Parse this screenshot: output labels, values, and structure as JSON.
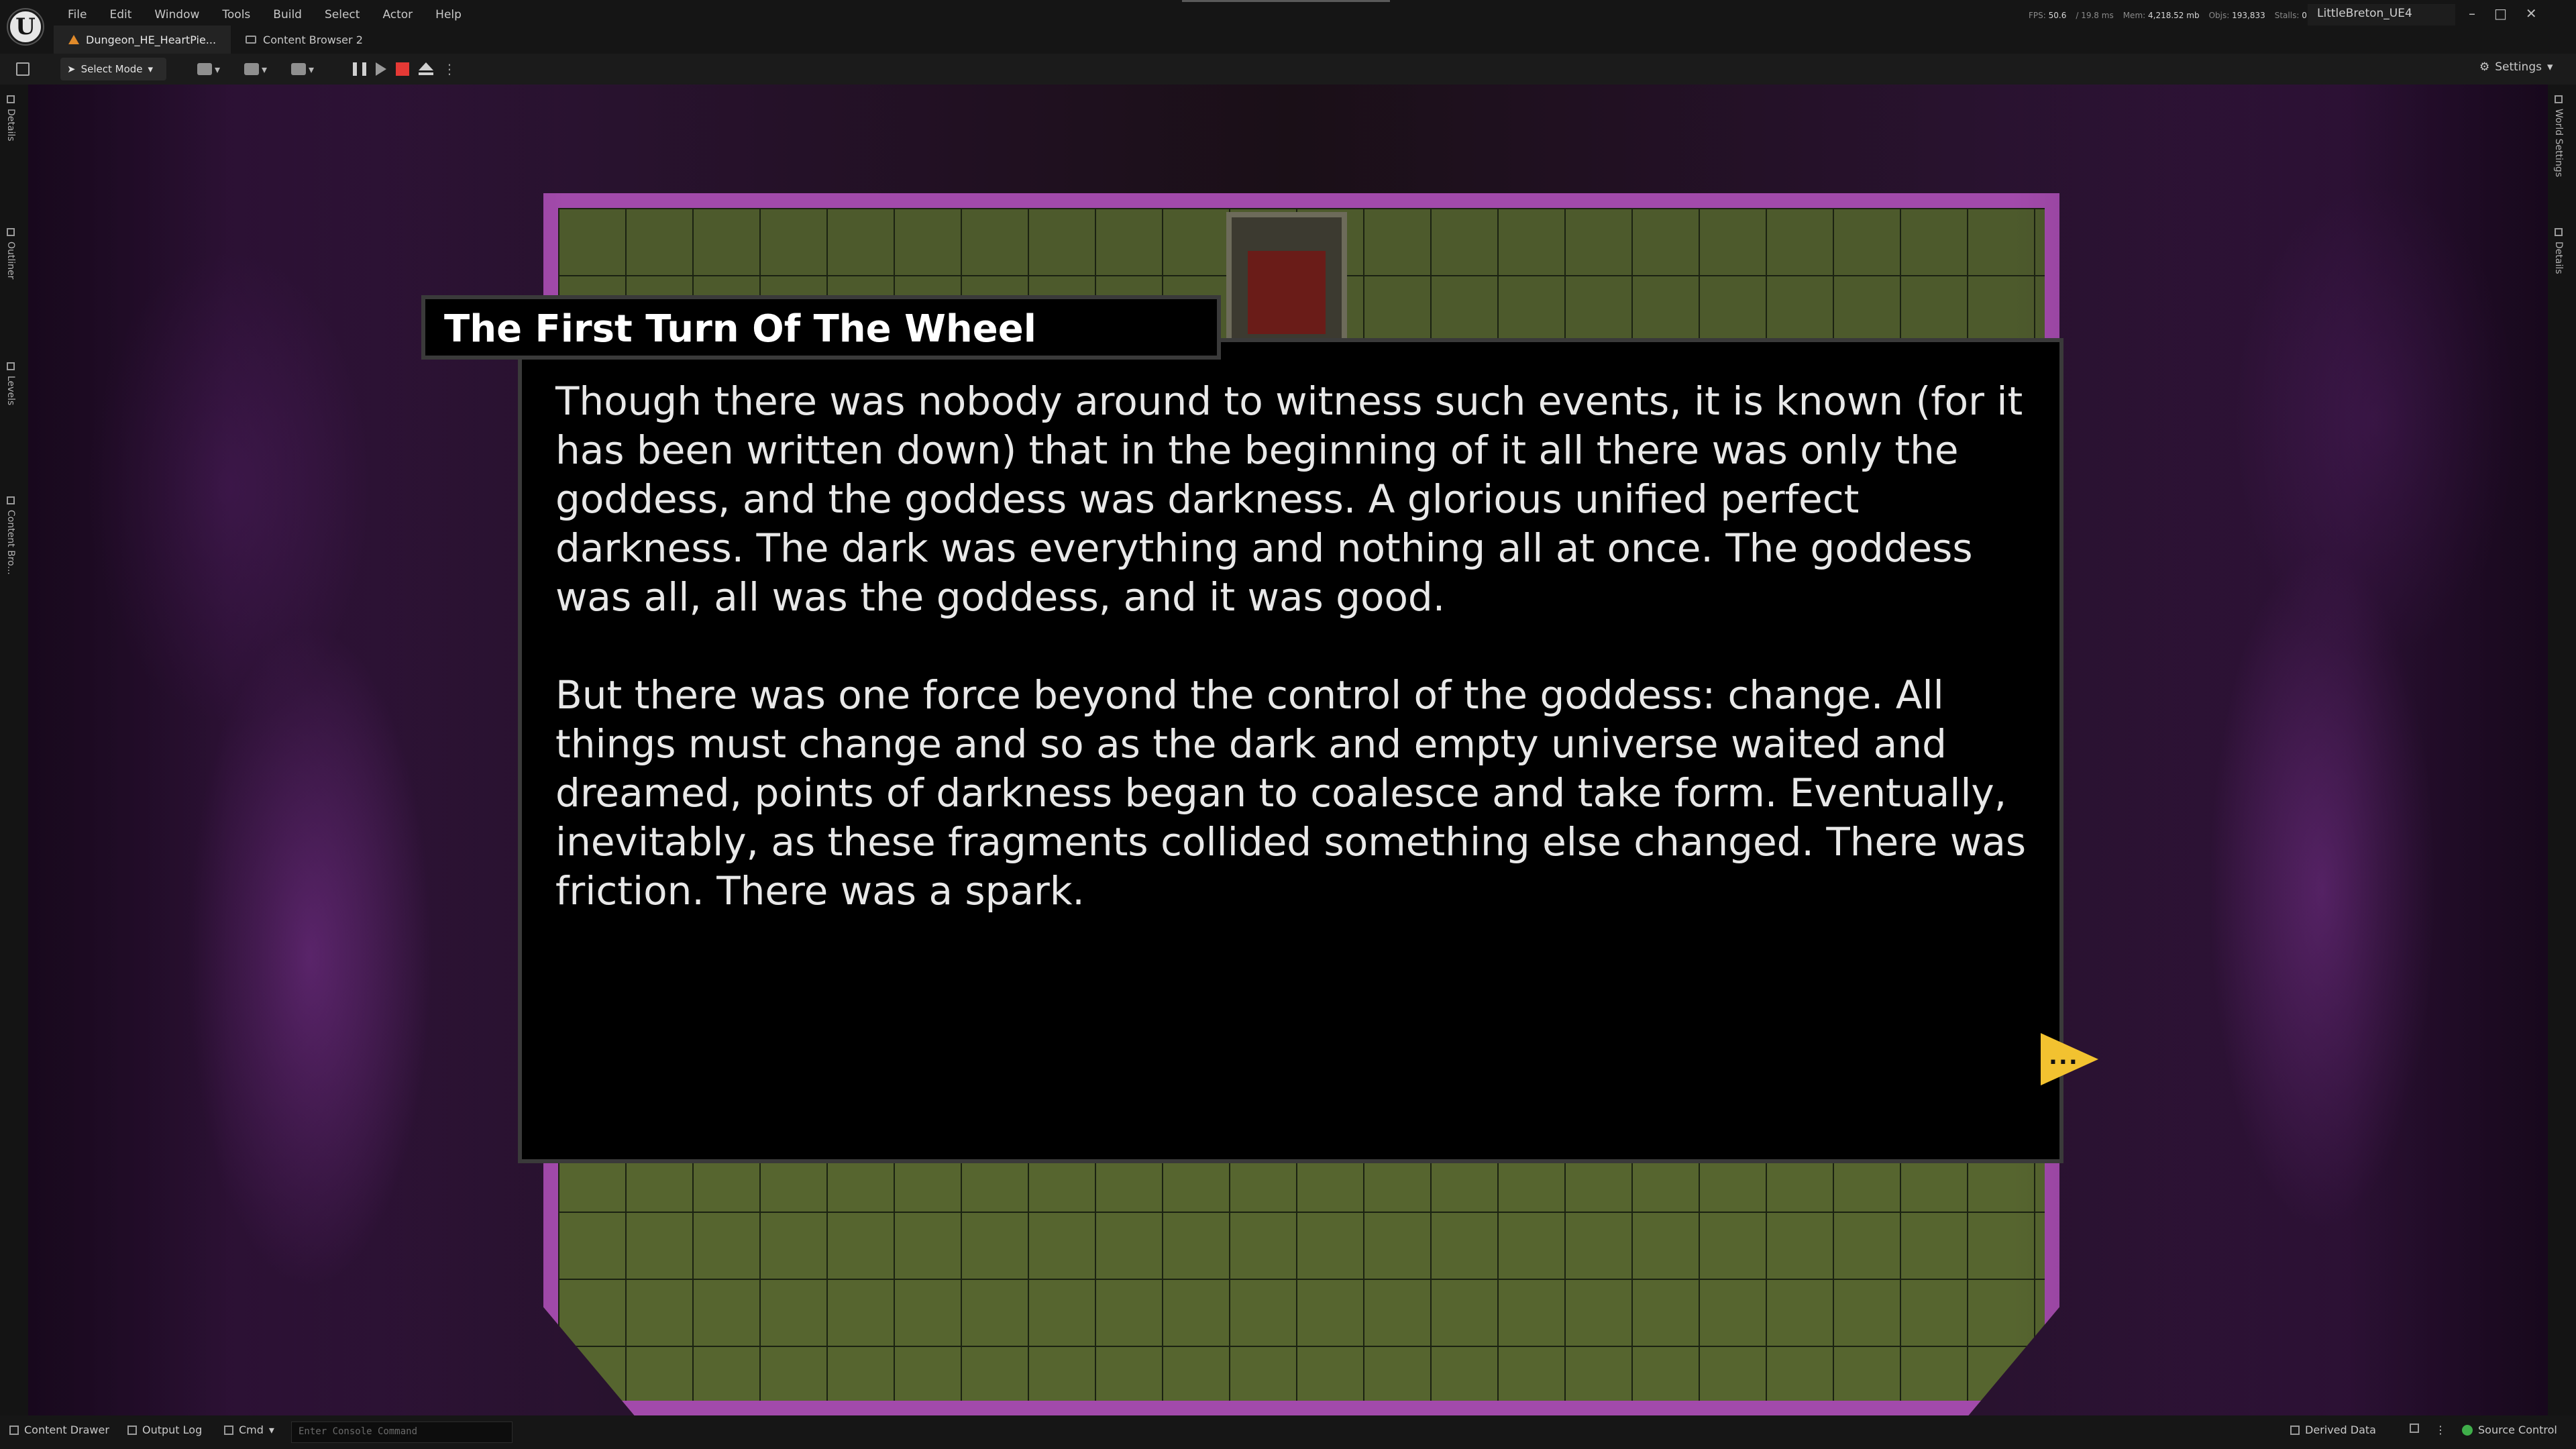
{
  "menu": [
    "File",
    "Edit",
    "Window",
    "Tools",
    "Build",
    "Select",
    "Actor",
    "Help"
  ],
  "tabs": [
    {
      "label": "Dungeon_HE_HeartPie..."
    },
    {
      "label": "Content Browser 2"
    }
  ],
  "stats": {
    "fps_label": "FPS:",
    "fps": "50.6",
    "ms": "/ 19.8 ms",
    "mem_label": "Mem:",
    "mem": "4,218.52 mb",
    "objs_label": "Objs:",
    "objs": "193,833",
    "stalls_label": "Stalls:",
    "stalls": "0"
  },
  "project_name": "LittleBreton_UE4",
  "toolbar": {
    "mode_label": "Select Mode",
    "settings_label": "Settings"
  },
  "left_tabs": [
    "Details",
    "Outliner",
    "Levels",
    "Content Bro..."
  ],
  "right_tabs": [
    "World Settings",
    "Details"
  ],
  "dialog": {
    "title": "The First Turn Of The Wheel",
    "paragraphs": [
      "Though there was nobody around to witness such events, it is known (for it has been written down) that in the beginning of it all there was only the goddess, and the goddess was darkness. A glorious unified perfect darkness. The dark was everything and nothing all at once. The goddess was all, all was the goddess, and it was good.",
      "But there was one force beyond the control of the goddess: change. All things must change and so as the dark and empty universe waited and dreamed, points of darkness began to coalesce and take form. Eventually, inevitably, as these fragments collided something else changed. There was friction. There was a spark."
    ],
    "next_glyph": "..."
  },
  "statusbar": {
    "content_drawer": "Content Drawer",
    "output_log": "Output Log",
    "cmd": "Cmd",
    "console_placeholder": "Enter Console Command",
    "derived_data": "Derived Data",
    "source_control": "Source Control"
  },
  "colors": {
    "accent_stop": "#e53935",
    "next_arrow": "#f2c230",
    "source_control_ok": "#3fae4a"
  }
}
